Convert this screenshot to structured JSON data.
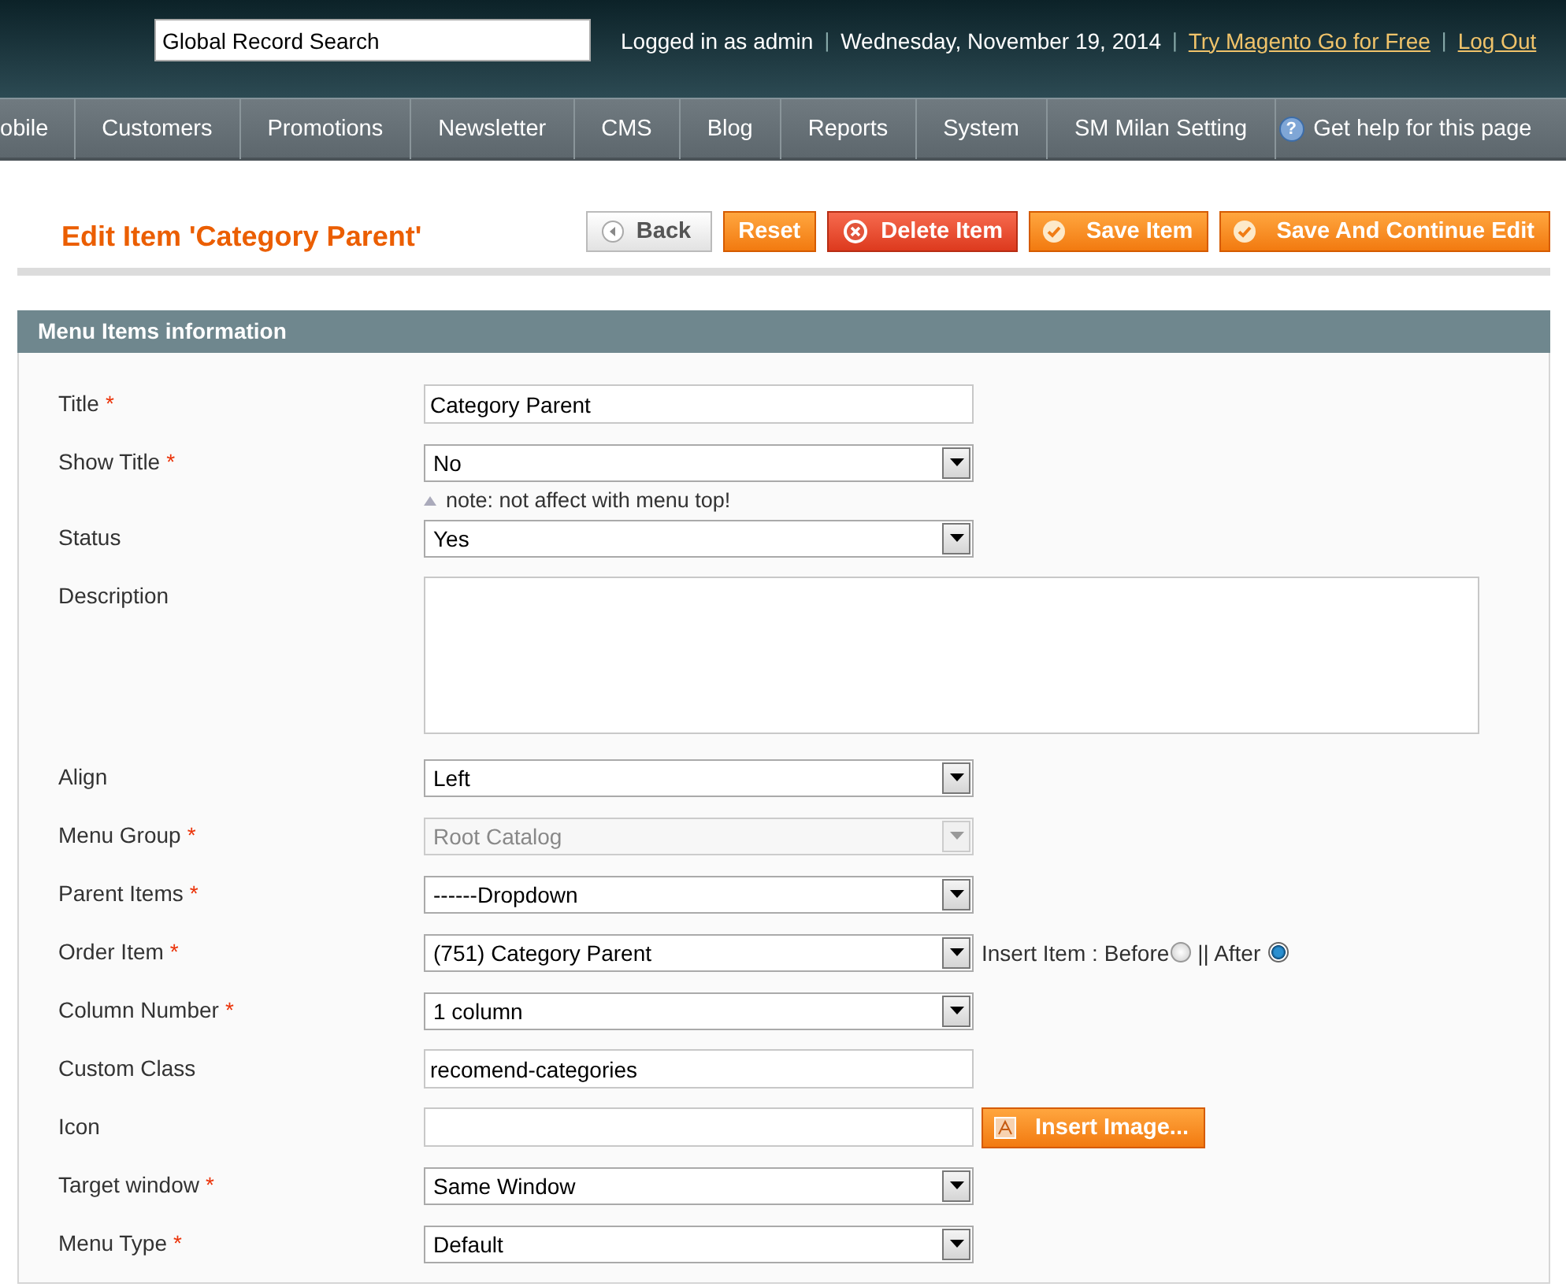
{
  "header": {
    "search": {
      "value": "Global Record Search"
    },
    "info": [
      {
        "kind": "text",
        "text": "Logged in as admin"
      },
      {
        "kind": "separator",
        "text": "|"
      },
      {
        "kind": "text",
        "text": "Wednesday, November 19, 2014"
      },
      {
        "kind": "separator",
        "text": "|"
      },
      {
        "kind": "link",
        "text": "Try Magento Go for Free"
      },
      {
        "kind": "separator",
        "text": "|"
      },
      {
        "kind": "link",
        "text": "Log Out"
      }
    ]
  },
  "nav": {
    "items": [
      "obile",
      "Customers",
      "Promotions",
      "Newsletter",
      "CMS",
      "Blog",
      "Reports",
      "System",
      "SM Milan Setting"
    ],
    "help_icon": "?",
    "help": "Get help for this page"
  },
  "page": {
    "title": "Edit Item 'Category Parent'",
    "buttons": [
      {
        "label": "Back",
        "kind": "back"
      },
      {
        "label": "Reset",
        "kind": "plain"
      },
      {
        "label": "Delete Item",
        "kind": "delete"
      },
      {
        "label": "Save Item",
        "kind": "save"
      },
      {
        "label": "Save And Continue Edit",
        "kind": "save"
      }
    ]
  },
  "section": {
    "title": "Menu Items information",
    "fields": [
      {
        "label": "Title",
        "required_mark": "*",
        "kind": "text",
        "value": "Category Parent",
        "disabled": false
      },
      {
        "label": "Show Title",
        "required_mark": "*",
        "kind": "select",
        "value": "No",
        "disabled": false,
        "note": "note: not affect with menu top!"
      },
      {
        "label": "Status",
        "kind": "select",
        "value": "Yes",
        "disabled": false
      },
      {
        "label": "Description",
        "kind": "textarea",
        "disabled": false
      },
      {
        "label": "Align",
        "kind": "select",
        "value": "Left",
        "disabled": false
      },
      {
        "label": "Menu Group",
        "required_mark": "*",
        "kind": "select",
        "value": "Root Catalog",
        "disabled": true
      },
      {
        "label": "Parent Items",
        "required_mark": "*",
        "kind": "select",
        "value": "------Dropdown",
        "disabled": false
      },
      {
        "label": "Order Item",
        "required_mark": "*",
        "kind": "select",
        "value": "(751) Category Parent",
        "disabled": false,
        "insert": {
          "prefix": "Insert Item :",
          "options": [
            {
              "label": "Before",
              "selected": false
            },
            {
              "label": "|| After",
              "selected": true
            }
          ]
        }
      },
      {
        "label": "Column Number",
        "required_mark": "*",
        "kind": "select",
        "value": "1 column",
        "disabled": false
      },
      {
        "label": "Custom Class",
        "kind": "text",
        "value": "recomend-categories",
        "disabled": false
      },
      {
        "label": "Icon",
        "kind": "text",
        "disabled": false,
        "button": "Insert Image..."
      },
      {
        "label": "Target window",
        "required_mark": "*",
        "kind": "select",
        "value": "Same Window",
        "disabled": false
      },
      {
        "label": "Menu Type",
        "required_mark": "*",
        "kind": "select",
        "value": "Default",
        "disabled": false
      }
    ]
  }
}
